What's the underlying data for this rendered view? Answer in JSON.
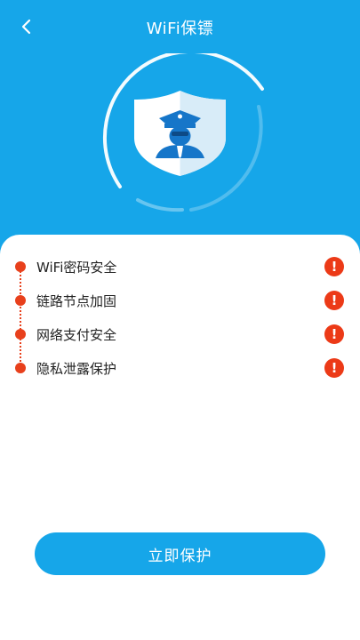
{
  "header": {
    "title": "WiFi保镖",
    "back_icon": "chevron-left-icon"
  },
  "hero": {
    "icon": "shield-guard-icon"
  },
  "checklist": {
    "items": [
      {
        "label": "WiFi密码安全",
        "status_icon": "exclamation-icon",
        "status_text": "!"
      },
      {
        "label": "链路节点加固",
        "status_icon": "exclamation-icon",
        "status_text": "!"
      },
      {
        "label": "网络支付安全",
        "status_icon": "exclamation-icon",
        "status_text": "!"
      },
      {
        "label": "隐私泄露保护",
        "status_icon": "exclamation-icon",
        "status_text": "!"
      }
    ]
  },
  "action": {
    "protect_label": "立即保护"
  },
  "colors": {
    "primary": "#16a6e9",
    "alert": "#ec3a17"
  }
}
